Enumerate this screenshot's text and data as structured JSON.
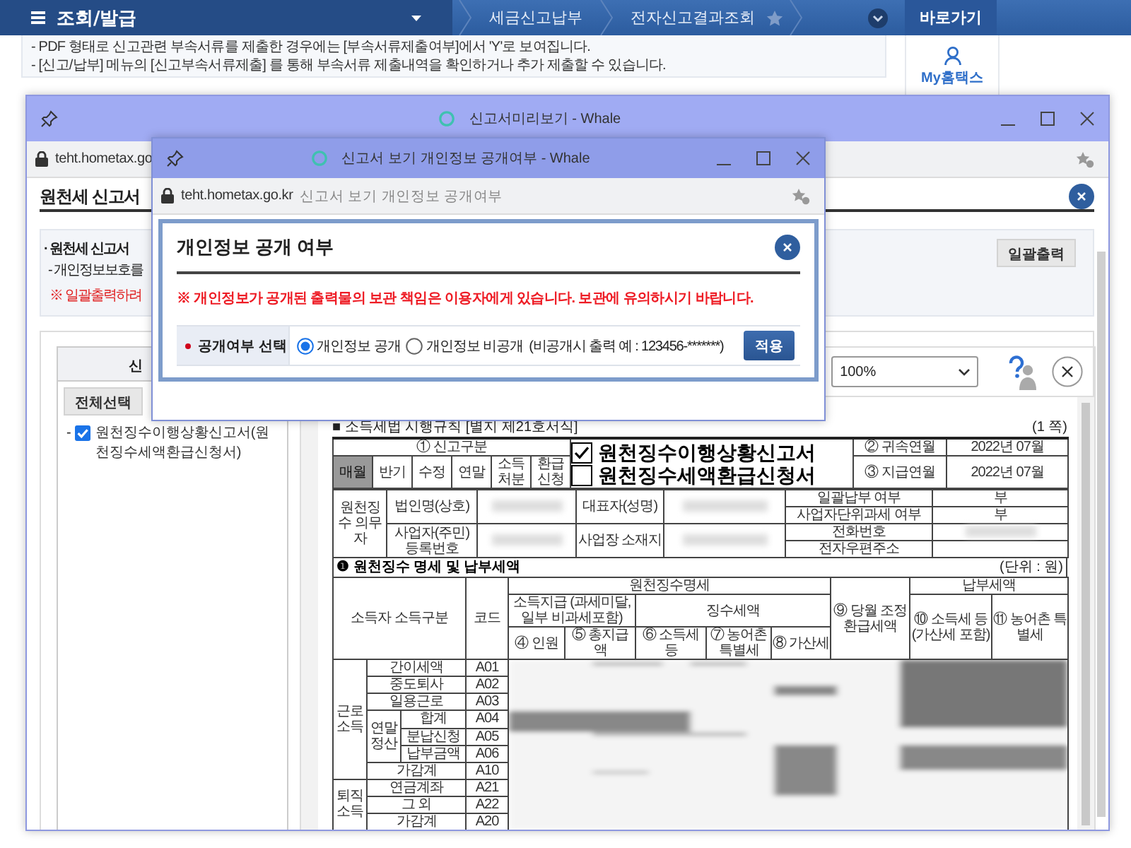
{
  "top_nav": {
    "menu": "조회/발급",
    "crumbs": [
      {
        "label": "세금신고납부",
        "starred": false
      },
      {
        "label": "전자신고결과조회",
        "starred": true
      }
    ],
    "shortcut": "바로가기"
  },
  "notices": [
    "- PDF 형태로 신고관련 부속서류를 제출한 경우에는 [부속서류제출여부]에서 'Y'로 보여집니다.",
    "- [신고/납부] 메뉴의 [신고부속서류제출] 를 통해 부속서류 제출내역을 확인하거나 추가 제출할 수 있습니다."
  ],
  "side_link": "My홈택스",
  "preview_window": {
    "title": "신고서미리보기 - Whale",
    "url": "teht.hometax.go",
    "heading": "원천세 신고서",
    "info": [
      "· 원천세 신고서",
      "- 개인정보보호를",
      "※ 일괄출력하려"
    ],
    "print_all": "일괄출력",
    "tree_header": "신",
    "tree_buttons": [
      "전체선택"
    ],
    "tree_items": [
      {
        "bullet": "-",
        "label": "원천징수이행상황신고서(원천징수세액환급신청서)",
        "checked": true
      }
    ],
    "zoom": "100%",
    "form": {
      "caption": "■ 소득세법 시행규칙 [별지 제21호서식]",
      "page": "(1 쪽)",
      "type_label": "① 신고구분",
      "types": [
        {
          "label": "매월",
          "selected": true
        },
        {
          "label": "반기",
          "selected": false
        },
        {
          "label": "수정",
          "selected": false
        },
        {
          "label": "연말",
          "selected": false
        },
        {
          "label": "소득처분",
          "selected": false
        },
        {
          "label": "환급신청",
          "selected": false
        }
      ],
      "titles": [
        {
          "label": "원천징수이행상황신고서",
          "checked": true
        },
        {
          "label": "원천징수세액환급신청서",
          "checked": false
        }
      ],
      "periods": [
        {
          "label": "② 귀속연월",
          "value": "2022년 07월"
        },
        {
          "label": "③ 지급연월",
          "value": "2022년 07월"
        }
      ],
      "agent_label": "원천징수 의무자",
      "agent_fields": [
        "법인명(상호)",
        "대표자(성명)",
        "사업자(주민) 등록번호",
        "사업장 소재지"
      ],
      "side_fields": [
        {
          "label": "일괄납부 여부",
          "value": "부"
        },
        {
          "label": "사업자단위과세 여부",
          "value": "부"
        },
        {
          "label": "전화번호",
          "redacted": true
        },
        {
          "label": "전자우편주소",
          "redacted": false
        }
      ],
      "section": "❶ 원천징수 명세 및 납부세액",
      "unit": "(단위 : 원)",
      "headers": [
        "소득자 소득구분",
        "코드",
        "원천징수명세",
        "⑨ 당월 조정 환급세액",
        "납부세액",
        "소득지급 (과세미달, 일부 비과세포함)",
        "징수세액",
        "⑩ 소득세 등 (가산세 포함)",
        "⑪ 농어촌 특별세",
        "④ 인원",
        "⑤ 총지급액",
        "⑥ 소득세 등",
        "⑦ 농어촌 특별세",
        "⑧ 가산세"
      ],
      "groups": [
        {
          "label": "근로소득",
          "rows": [
            {
              "label": "간이세액",
              "code": "A01"
            },
            {
              "label": "중도퇴사",
              "code": "A02"
            },
            {
              "label": "일용근로",
              "code": "A03"
            },
            {
              "label": "연말정산",
              "children": [
                {
                  "label": "합계",
                  "code": "A04"
                },
                {
                  "label": "분납신청",
                  "code": "A05"
                },
                {
                  "label": "납부금액",
                  "code": "A06"
                }
              ]
            },
            {
              "label": "가감계",
              "code": "A10"
            }
          ]
        },
        {
          "label": "퇴직소득",
          "rows": [
            {
              "label": "연금계좌",
              "code": "A21"
            },
            {
              "label": "그 외",
              "code": "A22"
            },
            {
              "label": "가감계",
              "code": "A20"
            }
          ]
        }
      ]
    }
  },
  "popup": {
    "title": "신고서 보기 개인정보 공개여부 - Whale",
    "url": "teht.hometax.go.kr",
    "page_title": "신고서 보기 개인정보 공개여부",
    "heading": "개인정보 공개 여부",
    "warning": "※ 개인정보가 공개된 출력물의 보관 책임은 이용자에게 있습니다. 보관에 유의하시기 바랍니다.",
    "field_label": "공개여부 선택",
    "options": [
      {
        "label": "개인정보 공개",
        "selected": true
      },
      {
        "label": "개인정보 비공개",
        "selected": false
      }
    ],
    "hint": "(비공개시 출력 예 : 123456-*******)",
    "apply": "적용"
  }
}
